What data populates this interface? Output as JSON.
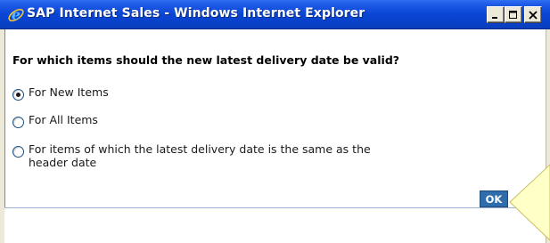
{
  "window": {
    "title": "SAP Internet Sales - Windows Internet Explorer"
  },
  "dialog": {
    "question": "For which items should the new latest delivery date be valid?",
    "options": [
      {
        "label": "For New Items",
        "selected": true
      },
      {
        "label": "For All Items",
        "selected": false
      },
      {
        "label_line1": "For items of which the latest delivery date is the same as the",
        "label_line2": "header date",
        "selected": false
      }
    ],
    "ok_label": "OK"
  },
  "colors": {
    "titlebar": "#0a45d4",
    "ok_button": "#2e6cac",
    "callout_fill": "#ffffc8"
  },
  "icons": {
    "app": "internet-explorer-icon",
    "minimize": "minimize-icon",
    "maximize": "maximize-icon",
    "close": "close-icon"
  }
}
